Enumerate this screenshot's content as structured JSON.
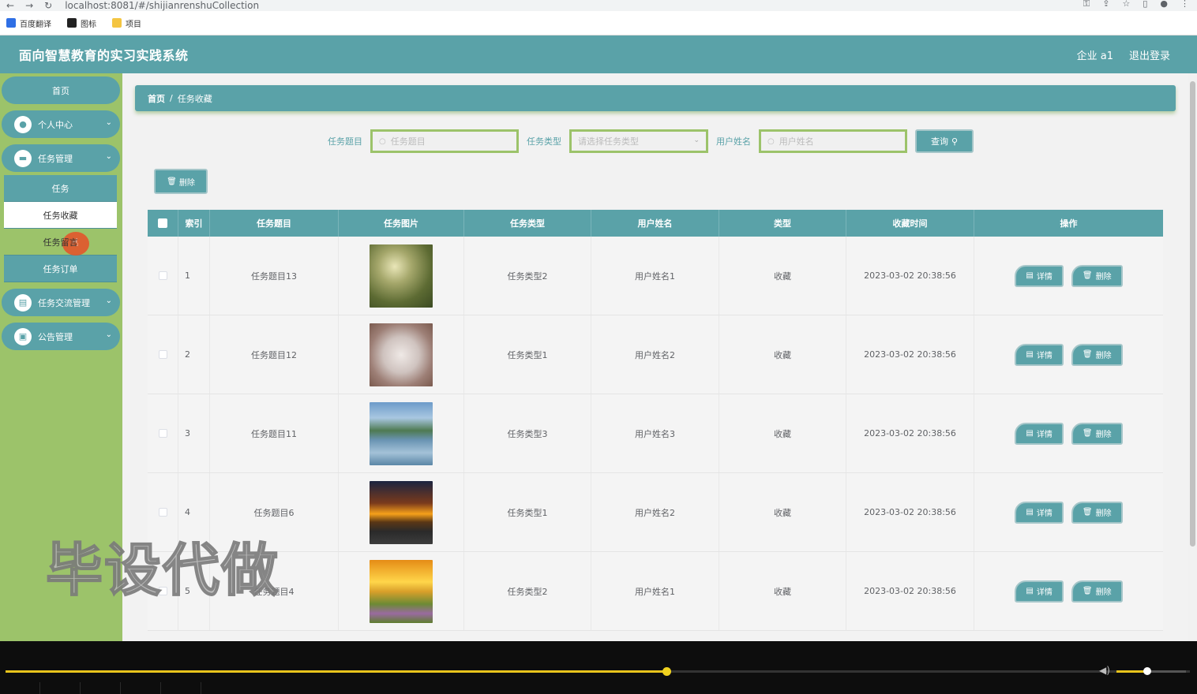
{
  "browser": {
    "url": "localhost:8081/#/shijianrenshuCollection",
    "bookmarks": [
      {
        "label": "百度翻译",
        "icon": "translate-icon",
        "color": "#2f6fe5"
      },
      {
        "label": "图标",
        "icon": "image-icon",
        "color": "#222222"
      },
      {
        "label": "项目",
        "icon": "folder-icon",
        "color": "#f4c542"
      }
    ]
  },
  "header": {
    "title": "面向智慧教育的实习实践系统",
    "user": "企业 a1",
    "logout": "退出登录"
  },
  "sidebar": {
    "home": "首页",
    "personal": "个人中心",
    "task_mgmt": "任务管理",
    "sub": [
      "任务",
      "任务收藏",
      "任务留言",
      "任务订单"
    ],
    "task_exchange": "任务交流管理",
    "notice": "公告管理"
  },
  "breadcrumb": {
    "home": "首页",
    "sep": "/",
    "current": "任务收藏"
  },
  "search": {
    "title_label": "任务题目",
    "title_placeholder": "任务题目",
    "type_label": "任务类型",
    "type_placeholder": "请选择任务类型",
    "user_label": "用户姓名",
    "user_placeholder": "用户姓名",
    "query": "查询"
  },
  "bulk_delete": "删除",
  "table": {
    "headers": [
      "索引",
      "任务题目",
      "任务图片",
      "任务类型",
      "用户姓名",
      "类型",
      "收藏时间",
      "操作"
    ],
    "rows": [
      {
        "index": "1",
        "title": "任务题目13",
        "type": "任务类型2",
        "user": "用户姓名1",
        "kind": "收藏",
        "time": "2023-03-02 20:38:56"
      },
      {
        "index": "2",
        "title": "任务题目12",
        "type": "任务类型1",
        "user": "用户姓名2",
        "kind": "收藏",
        "time": "2023-03-02 20:38:56"
      },
      {
        "index": "3",
        "title": "任务题目11",
        "type": "任务类型3",
        "user": "用户姓名3",
        "kind": "收藏",
        "time": "2023-03-02 20:38:56"
      },
      {
        "index": "4",
        "title": "任务题目6",
        "type": "任务类型1",
        "user": "用户姓名2",
        "kind": "收藏",
        "time": "2023-03-02 20:38:56"
      },
      {
        "index": "5",
        "title": "任务题目4",
        "type": "任务类型2",
        "user": "用户姓名1",
        "kind": "收藏",
        "time": "2023-03-02 20:38:56"
      }
    ],
    "detail": "详情",
    "delete": "删除"
  },
  "watermark": "毕设代做",
  "player": {
    "progress": 0.558,
    "volume": 0.44
  },
  "colors": {
    "primary": "#5aa2a8",
    "accent": "#9cc36a"
  }
}
